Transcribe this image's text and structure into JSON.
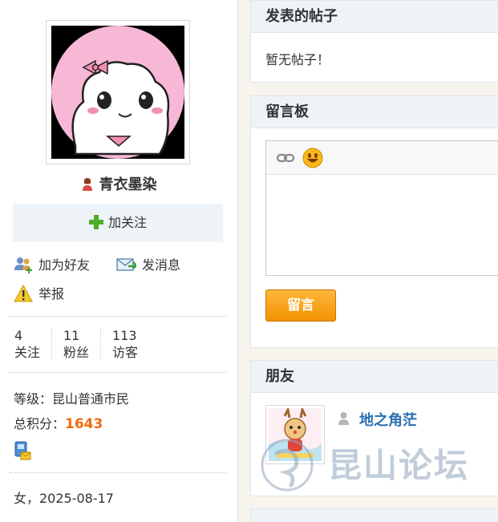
{
  "profile": {
    "username": "青衣墨染",
    "follow_label": "加关注",
    "actions": {
      "add_friend": "加为好友",
      "send_message": "发消息",
      "report": "举报"
    },
    "stats": [
      {
        "count": "4",
        "label": "关注"
      },
      {
        "count": "11",
        "label": "粉丝"
      },
      {
        "count": "113",
        "label": "访客"
      }
    ],
    "level_label": "等级：",
    "level_value": "昆山普通市民",
    "credits_label": "总积分：",
    "credits_value": "1643",
    "gender_birthday": "女，2025-08-17"
  },
  "posts": {
    "title": "发表的帖子",
    "empty_text": "暂无帖子！"
  },
  "guestbook": {
    "title": "留言板",
    "submit_label": "留言",
    "toolbar_icons": [
      "link-icon",
      "smiley-icon"
    ]
  },
  "friends": {
    "title": "朋友",
    "items": [
      {
        "name": "地之角茫"
      }
    ]
  },
  "watermark": {
    "text": "昆山论坛"
  },
  "colors": {
    "accent_orange": "#f26c0c",
    "link_blue": "#2a6fb0",
    "panel_header_bg": "#eef3f8",
    "button_orange": "#f39200"
  }
}
